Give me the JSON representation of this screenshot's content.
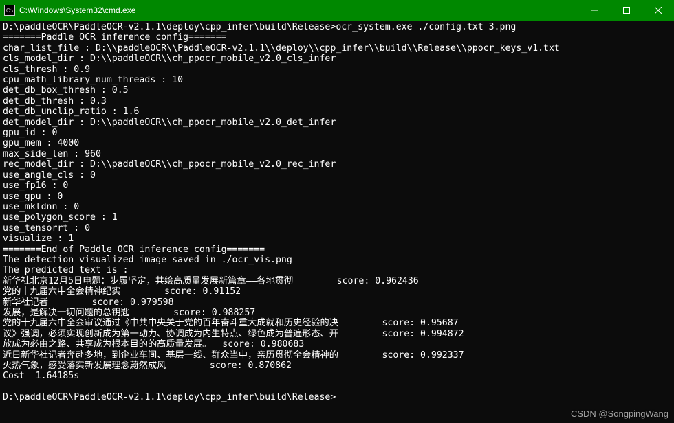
{
  "titlebar": {
    "icon_label": "C:\\",
    "title": "C:\\Windows\\System32\\cmd.exe"
  },
  "window_controls": {
    "minimize": "minimize",
    "maximize": "maximize",
    "close": "close"
  },
  "terminal": {
    "prompt1": "D:\\paddleOCR\\PaddleOCR-v2.1.1\\deploy\\cpp_infer\\build\\Release>",
    "cmd1": "ocr_system.exe ./config.txt 3.png",
    "lines": [
      "=======Paddle OCR inference config=======",
      "char_list_file : D:\\\\paddleOCR\\\\PaddleOCR-v2.1.1\\\\deploy\\\\cpp_infer\\\\build\\\\Release\\\\ppocr_keys_v1.txt",
      "cls_model_dir : D:\\\\paddleOCR\\\\ch_ppocr_mobile_v2.0_cls_infer",
      "cls_thresh : 0.9",
      "cpu_math_library_num_threads : 10",
      "det_db_box_thresh : 0.5",
      "det_db_thresh : 0.3",
      "det_db_unclip_ratio : 1.6",
      "det_model_dir : D:\\\\paddleOCR\\\\ch_ppocr_mobile_v2.0_det_infer",
      "gpu_id : 0",
      "gpu_mem : 4000",
      "max_side_len : 960",
      "rec_model_dir : D:\\\\paddleOCR\\\\ch_ppocr_mobile_v2.0_rec_infer",
      "use_angle_cls : 0",
      "use_fp16 : 0",
      "use_gpu : 0",
      "use_mkldnn : 0",
      "use_polygon_score : 1",
      "use_tensorrt : 0",
      "visualize : 1",
      "=======End of Paddle OCR inference config=======",
      "The detection visualized image saved in ./ocr_vis.png",
      "The predicted text is :",
      "新华社北京12月5日电题：步履坚定，共绘高质量发展新篇章——各地贯彻        score: 0.962436",
      "党的十九届六中全会精神纪实        score: 0.91152",
      "新华社记者        score: 0.979598",
      "发展，是解决一切问题的总钥匙        score: 0.988257",
      "党的十九届六中全会审议通过《中共中央关于党的百年奋斗重大成就和历史经验的决        score: 0.95687",
      "议》强调，必须实现创新成为第一动力、协调成为内生特点、绿色成为普遍形态、开        score: 0.994872",
      "放成为必由之路、共享成为根本目的的高质量发展。  score: 0.980683",
      "近日新华社记者奔赴多地，到企业车间、基层一线、群众当中，亲历贯彻全会精神的        score: 0.992337",
      "火热气象，感受落实新发展理念蔚然成风        score: 0.870862",
      "Cost  1.64185s",
      ""
    ],
    "prompt2": "D:\\paddleOCR\\PaddleOCR-v2.1.1\\deploy\\cpp_infer\\build\\Release>"
  },
  "watermark": "CSDN @SongpingWang"
}
